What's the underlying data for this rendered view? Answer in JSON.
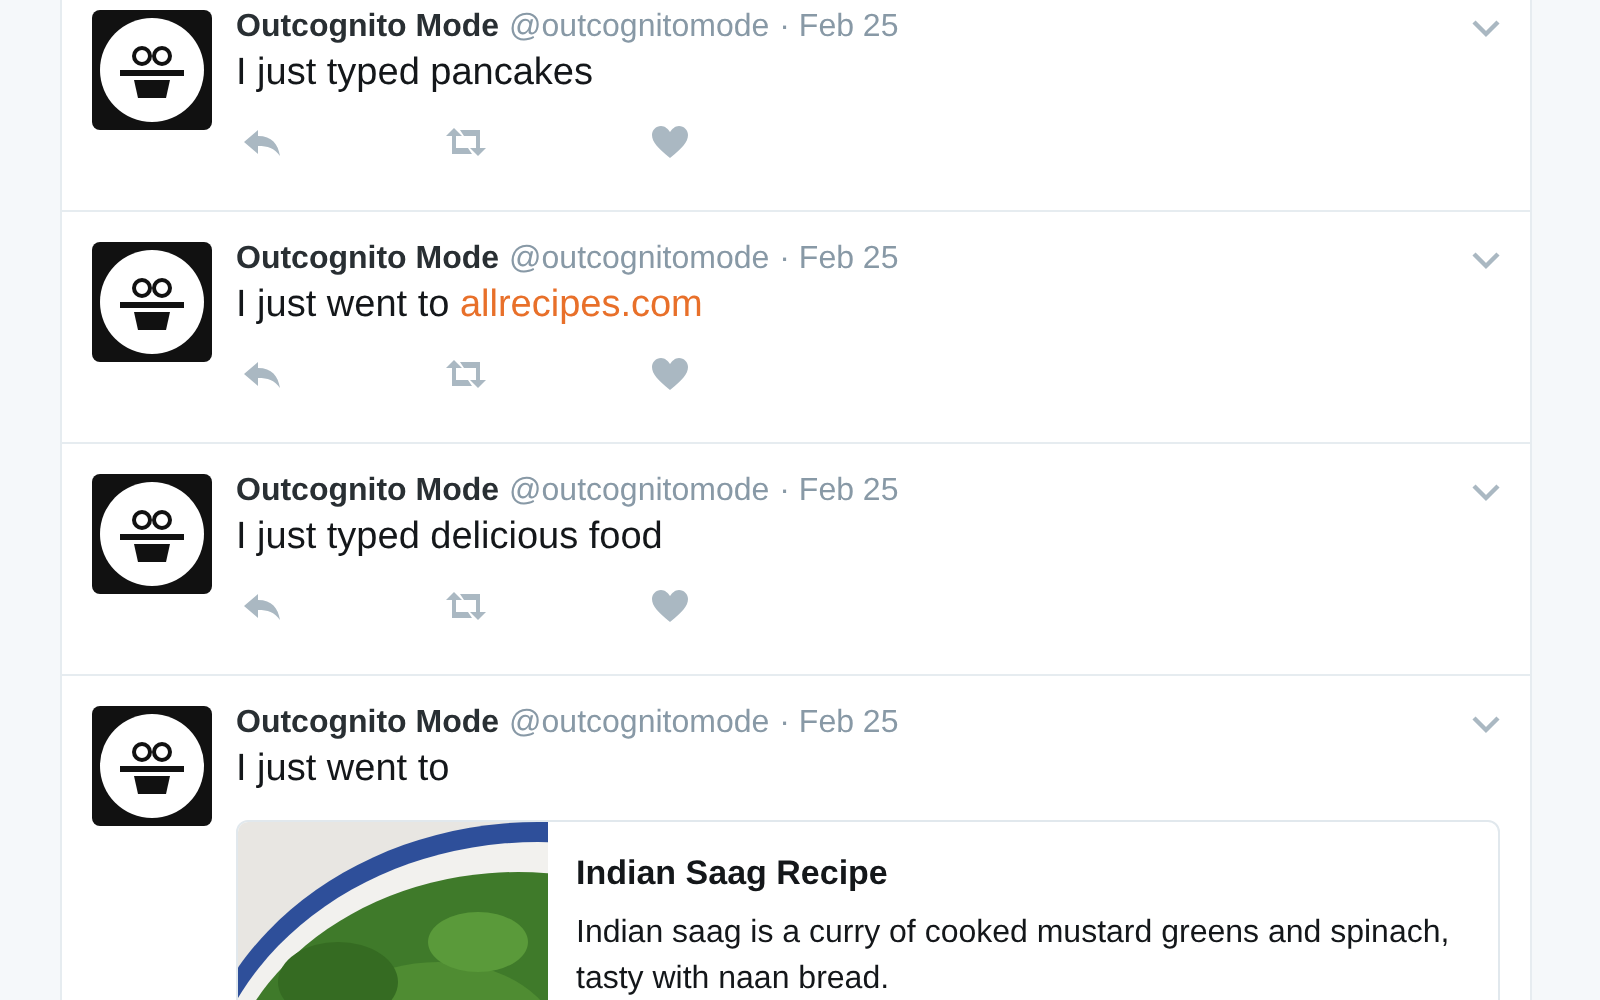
{
  "tweets": [
    {
      "name": "Outcognito Mode",
      "handle": "@outcognitomode",
      "date": "· Feb 25",
      "text": "I just typed pancakes"
    },
    {
      "name": "Outcognito Mode",
      "handle": "@outcognitomode",
      "date": "· Feb 25",
      "text": "I just went to",
      "link": "allrecipes.com"
    },
    {
      "name": "Outcognito Mode",
      "handle": "@outcognitomode",
      "date": "· Feb 25",
      "text": "I just typed delicious food"
    },
    {
      "name": "Outcognito Mode",
      "handle": "@outcognitomode",
      "date": "· Feb 25",
      "text": "I just went to",
      "card": {
        "title": "Indian Saag Recipe",
        "description": "Indian saag is a curry of cooked mustard greens and spinach, tasty with naan bread."
      }
    }
  ]
}
